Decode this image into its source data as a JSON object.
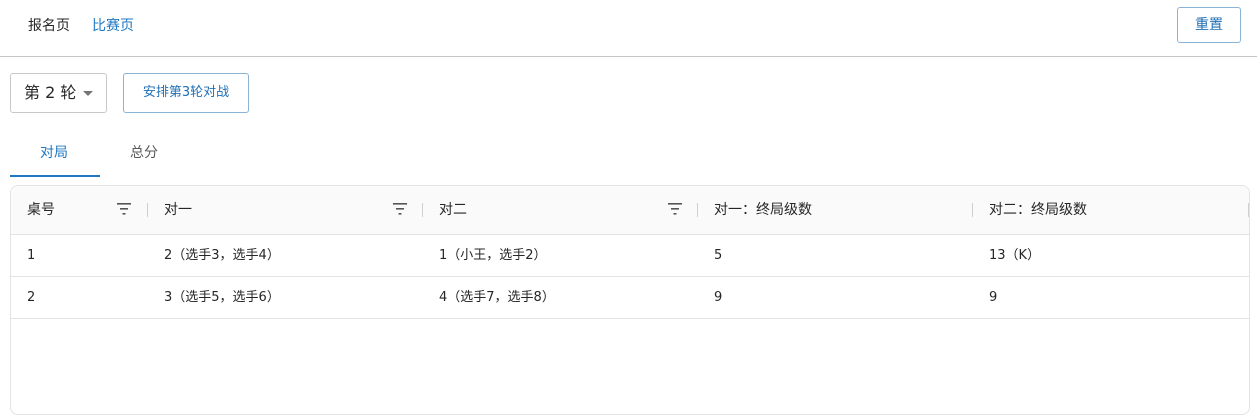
{
  "nav": {
    "signup_label": "报名页",
    "match_label": "比赛页",
    "reset_label": "重置"
  },
  "toolbar": {
    "round_select_value": "第 2 轮",
    "arrange_button_label": "安排第3轮对战"
  },
  "tabs": [
    {
      "label": "对局",
      "active": true
    },
    {
      "label": "总分",
      "active": false
    }
  ],
  "table": {
    "columns": [
      {
        "label": "桌号",
        "filterable": true
      },
      {
        "label": "对一",
        "filterable": true
      },
      {
        "label": "对二",
        "filterable": true
      },
      {
        "label": "对一：终局级数",
        "filterable": false
      },
      {
        "label": "对二：终局级数",
        "filterable": false
      }
    ],
    "rows": [
      [
        "1",
        "2（选手3，选手4）",
        "1（小王，选手2）",
        "5",
        "13（K）"
      ],
      [
        "2",
        "3（选手5，选手6）",
        "4（选手7，选手8）",
        "9",
        "9"
      ]
    ]
  },
  "colors": {
    "accent": "#1f78c1",
    "border": "#e3e3e3"
  },
  "icons": {
    "filter": "filter-icon",
    "caret": "chevron-down-icon"
  }
}
